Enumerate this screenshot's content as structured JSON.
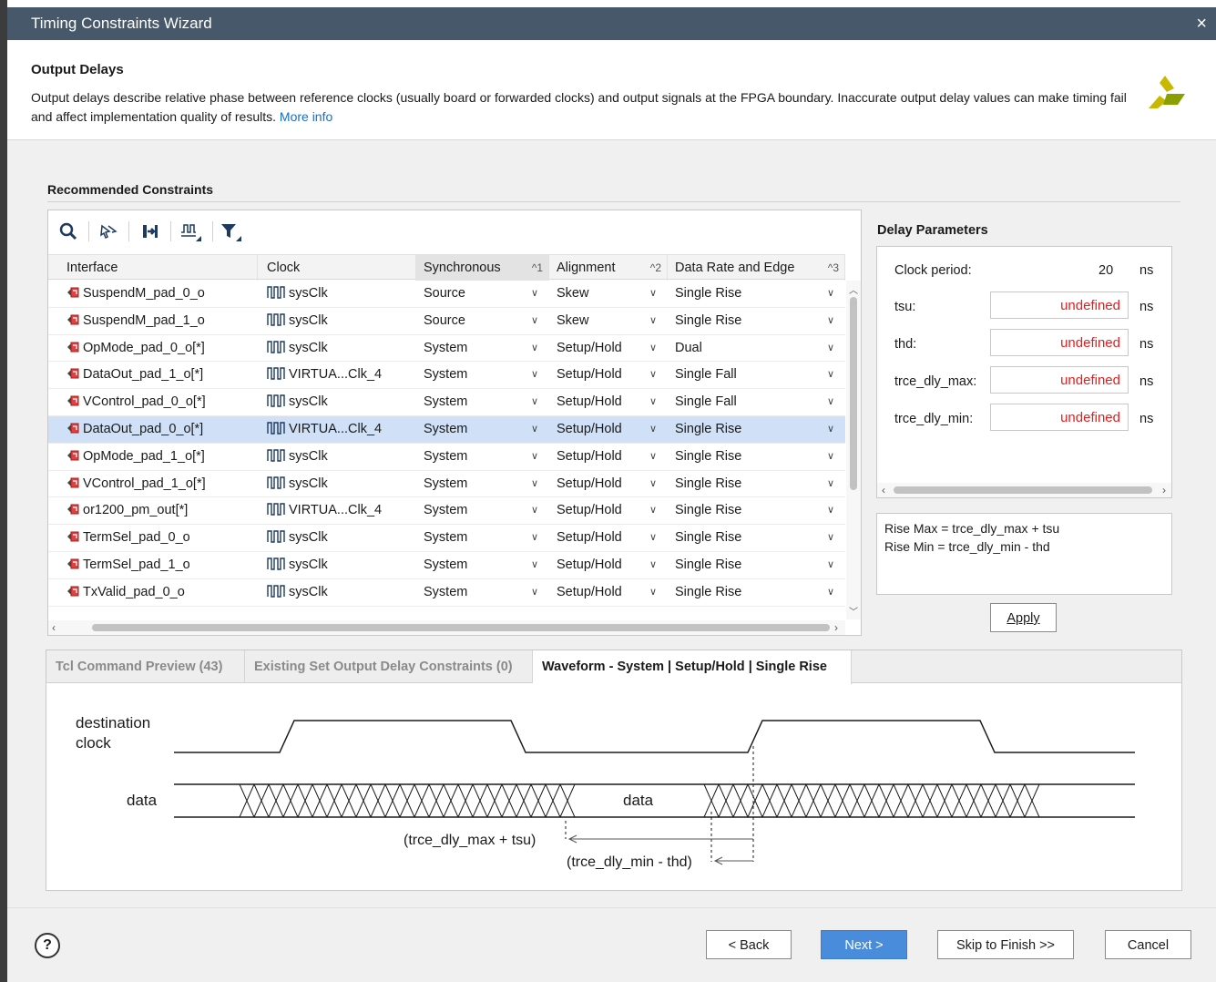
{
  "window": {
    "title": "Timing Constraints Wizard",
    "close_label": "×"
  },
  "header": {
    "title": "Output Delays",
    "description": "Output delays describe relative phase between reference clocks (usually board or forwarded clocks) and output signals at the FPGA boundary. Inaccurate output delay values can make timing fail and affect implementation quality of results.",
    "more_info": "More info"
  },
  "recommended": {
    "title": "Recommended Constraints",
    "toolbar_icons": [
      "search-icon",
      "select-icon",
      "expand-icon",
      "waveform-icon",
      "filter-icon"
    ],
    "columns": [
      {
        "label": "Interface",
        "sort": ""
      },
      {
        "label": "Clock",
        "sort": ""
      },
      {
        "label": "Synchronous",
        "sort": "^1"
      },
      {
        "label": "Alignment",
        "sort": "^2"
      },
      {
        "label": "Data Rate and Edge",
        "sort": "^3"
      }
    ],
    "selected_row": 5,
    "rows": [
      {
        "interface": "SuspendM_pad_0_o",
        "clock": "sysClk",
        "sync": "Source",
        "align": "Skew",
        "rate": "Single Rise"
      },
      {
        "interface": "SuspendM_pad_1_o",
        "clock": "sysClk",
        "sync": "Source",
        "align": "Skew",
        "rate": "Single Rise"
      },
      {
        "interface": "OpMode_pad_0_o[*]",
        "clock": "sysClk",
        "sync": "System",
        "align": "Setup/Hold",
        "rate": "Dual"
      },
      {
        "interface": "DataOut_pad_1_o[*]",
        "clock": "VIRTUA...Clk_4",
        "sync": "System",
        "align": "Setup/Hold",
        "rate": "Single Fall"
      },
      {
        "interface": "VControl_pad_0_o[*]",
        "clock": "sysClk",
        "sync": "System",
        "align": "Setup/Hold",
        "rate": "Single Fall"
      },
      {
        "interface": "DataOut_pad_0_o[*]",
        "clock": "VIRTUA...Clk_4",
        "sync": "System",
        "align": "Setup/Hold",
        "rate": "Single Rise"
      },
      {
        "interface": "OpMode_pad_1_o[*]",
        "clock": "sysClk",
        "sync": "System",
        "align": "Setup/Hold",
        "rate": "Single Rise"
      },
      {
        "interface": "VControl_pad_1_o[*]",
        "clock": "sysClk",
        "sync": "System",
        "align": "Setup/Hold",
        "rate": "Single Rise"
      },
      {
        "interface": "or1200_pm_out[*]",
        "clock": "VIRTUA...Clk_4",
        "sync": "System",
        "align": "Setup/Hold",
        "rate": "Single Rise"
      },
      {
        "interface": "TermSel_pad_0_o",
        "clock": "sysClk",
        "sync": "System",
        "align": "Setup/Hold",
        "rate": "Single Rise"
      },
      {
        "interface": "TermSel_pad_1_o",
        "clock": "sysClk",
        "sync": "System",
        "align": "Setup/Hold",
        "rate": "Single Rise"
      },
      {
        "interface": "TxValid_pad_0_o",
        "clock": "sysClk",
        "sync": "System",
        "align": "Setup/Hold",
        "rate": "Single Rise"
      }
    ]
  },
  "delay_params": {
    "title": "Delay Parameters",
    "clock_period_label": "Clock period:",
    "clock_period_value": "20",
    "unit": "ns",
    "fields": [
      {
        "label": "tsu:",
        "value": "undefined"
      },
      {
        "label": "thd:",
        "value": "undefined"
      },
      {
        "label": "trce_dly_max:",
        "value": "undefined"
      },
      {
        "label": "trce_dly_min:",
        "value": "undefined"
      }
    ],
    "formula_1": "Rise Max = trce_dly_max + tsu",
    "formula_2": "Rise Min = trce_dly_min - thd",
    "apply_label": "Apply"
  },
  "tabs": [
    {
      "label": "Tcl Command Preview (43)",
      "active": false
    },
    {
      "label": "Existing Set Output Delay Constraints (0)",
      "active": false
    },
    {
      "label": "Waveform - System | Setup/Hold | Single Rise",
      "active": true
    }
  ],
  "waveform": {
    "clock_label_1": "destination",
    "clock_label_2": "clock",
    "data_label": "data",
    "data_center_label": "data",
    "max_annotation": "(trce_dly_max + tsu)",
    "min_annotation": "(trce_dly_min - thd)"
  },
  "footer": {
    "back": "< Back",
    "next": "Next >",
    "skip": "Skip to Finish >>",
    "cancel": "Cancel",
    "help": "?"
  },
  "colors": {
    "titlebar": "#46586a",
    "selected_row": "#cfe0f7",
    "undefined_text": "#e02020",
    "link": "#1a6fc4",
    "primary_button": "#4a8cdc"
  }
}
